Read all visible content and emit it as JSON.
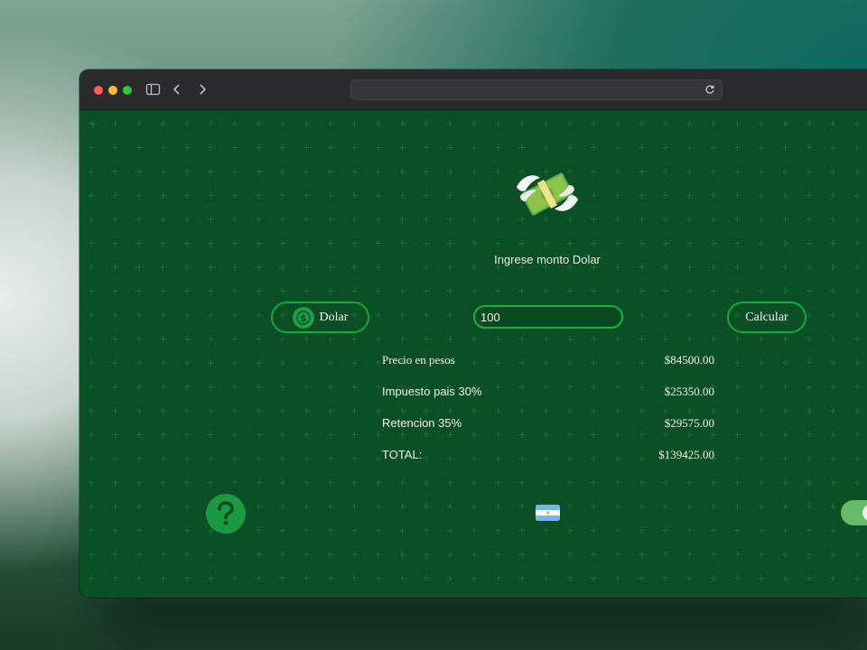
{
  "app": {
    "prompt": "Ingrese monto Dolar",
    "currency_label": "Dolar",
    "currency_icon": "dollar-coin-icon",
    "amount_value": "100",
    "calculate_label": "Calcular"
  },
  "results": [
    {
      "label": "Precio en pesos",
      "value": "$84500.00"
    },
    {
      "label": "Impuesto pais 30%",
      "value": "$25350.00"
    },
    {
      "label": "Retencion 35%",
      "value": "$29575.00"
    },
    {
      "label": "TOTAL:",
      "value": "$139425.00"
    }
  ],
  "footer": {
    "help_icon": "question-mark-icon",
    "flag_icon": "argentina-flag-icon",
    "theme_toggle": "toggle-switch"
  },
  "colors": {
    "background": "#0b4f24",
    "accent": "#17a83e",
    "text": "#f0f5f0"
  }
}
